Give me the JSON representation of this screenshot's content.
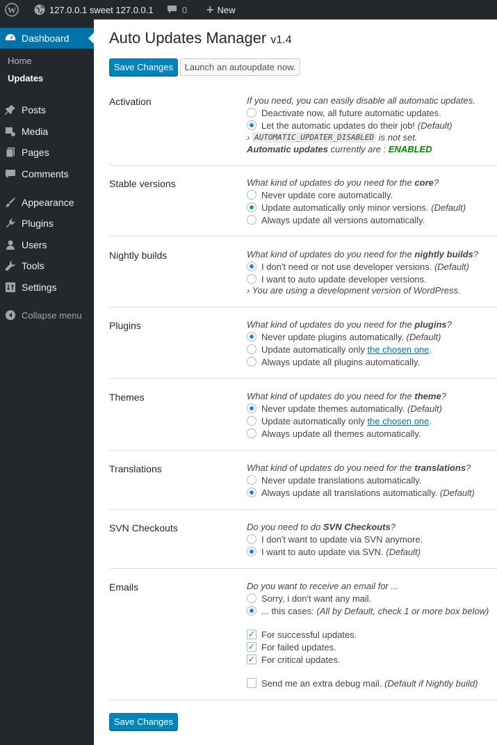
{
  "adminbar": {
    "site": "127.0.0.1 sweet 127.0.0.1",
    "comments": "0",
    "new": "New"
  },
  "menu": {
    "dashboard": "Dashboard",
    "home": "Home",
    "updates": "Updates",
    "posts": "Posts",
    "media": "Media",
    "pages": "Pages",
    "comments": "Comments",
    "appearance": "Appearance",
    "plugins": "Plugins",
    "users": "Users",
    "tools": "Tools",
    "settings": "Settings",
    "collapse": "Collapse menu"
  },
  "page": {
    "title": "Auto Updates Manager",
    "version": "v1.4",
    "save": "Save Changes",
    "launch": "Launch an autoupdate now."
  },
  "activation": {
    "label": "Activation",
    "q": "If you need, you can easily disable all automatic updates.",
    "o1": "Deactivate now, all future automatic updates.",
    "o2": "Let the automatic updates do their job!",
    "o2_default": "(Default)",
    "const_prefix": "›",
    "const": "AUTOMATIC_UPDATER_DISABLED",
    "const_suffix": "is not set.",
    "status_a": "Automatic updates",
    "status_b": "currently are :",
    "status": "ENABLED"
  },
  "stable": {
    "label": "Stable versions",
    "q": "What kind of updates do you need for the",
    "qb": "core",
    "qe": "?",
    "o1": "Never update core automatically.",
    "o2": "Update automatically only minor versions.",
    "o2_default": "(Default)",
    "o3": "Always update all versions automatically."
  },
  "nightly": {
    "label": "Nightly builds",
    "q": "What kind of updates do you need for the",
    "qb": "nightly builds",
    "qe": "?",
    "o1": "I don't need or not use developer versions.",
    "o1_default": "(Default)",
    "o2": "I want to auto update developer versions.",
    "note": "› You are using a development version of WordPress."
  },
  "plugins": {
    "label": "Plugins",
    "q": "What kind of updates do you need for the",
    "qb": "plugins",
    "qe": "?",
    "o1": "Never update plugins automatically.",
    "o1_default": "(Default)",
    "o2a": "Update automatically only",
    "o2link": "the chosen one",
    "o2e": ".",
    "o3": "Always update all plugins automatically."
  },
  "themes": {
    "label": "Themes",
    "q": "What kind of updates do you need for the",
    "qb": "theme",
    "qe": "?",
    "o1": "Never update themes automatically.",
    "o1_default": "(Default)",
    "o2a": "Update automatically only",
    "o2link": "the chosen one",
    "o2e": ".",
    "o3": "Always update all themes automatically."
  },
  "translations": {
    "label": "Translations",
    "q": "What kind of updates do you need for the",
    "qb": "translations",
    "qe": "?",
    "o1": "Never update translations automatically.",
    "o2": "Always update all translations automatically.",
    "o2_default": "(Default)"
  },
  "svn": {
    "label": "SVN Checkouts",
    "q": "Do you need to do",
    "qb": "SVN Checkouts",
    "qe": "?",
    "o1": "I don't want to update via SVN anymore.",
    "o2": "I want to auto update via SVN.",
    "o2_default": "(Default)"
  },
  "emails": {
    "label": "Emails",
    "q": "Do you want to receive an email for ...",
    "o1": "Sorry, i don't want any mail.",
    "o2": "... this cases:",
    "o2_note": "(All by Default, check 1 or more box below)",
    "c1": "For successful updates.",
    "c2": "For failed updates.",
    "c3": "For critical updates.",
    "c4": "Send me an extra debug mail.",
    "c4_note": "(Default if Nightly build)"
  }
}
